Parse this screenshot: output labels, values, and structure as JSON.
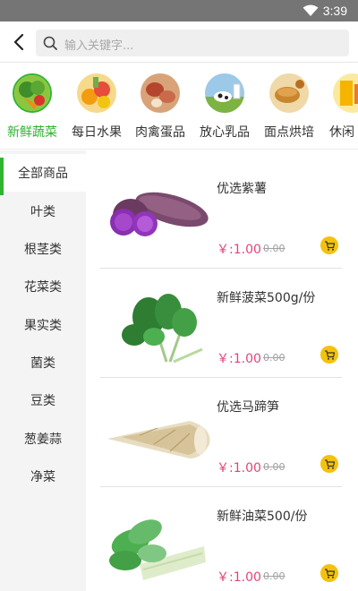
{
  "status_bar": {
    "time": "3:39"
  },
  "search": {
    "placeholder": "输入关键字..."
  },
  "top_categories": [
    {
      "label": "新鲜蔬菜",
      "active": true
    },
    {
      "label": "每日水果",
      "active": false
    },
    {
      "label": "肉禽蛋品",
      "active": false
    },
    {
      "label": "放心乳品",
      "active": false
    },
    {
      "label": "面点烘培",
      "active": false
    },
    {
      "label": "休闲",
      "active": false
    }
  ],
  "sidebar": {
    "items": [
      {
        "label": "全部商品",
        "active": true
      },
      {
        "label": "叶类",
        "active": false
      },
      {
        "label": "根茎类",
        "active": false
      },
      {
        "label": "花菜类",
        "active": false
      },
      {
        "label": "果实类",
        "active": false
      },
      {
        "label": "菌类",
        "active": false
      },
      {
        "label": "豆类",
        "active": false
      },
      {
        "label": "葱姜蒜",
        "active": false
      },
      {
        "label": "净菜",
        "active": false
      }
    ]
  },
  "products": [
    {
      "name": "优选紫薯",
      "price": "￥:1.00",
      "old_price": "0.00",
      "image": "purple-sweet-potato-image"
    },
    {
      "name": "新鲜菠菜500g/份",
      "price": "￥:1.00",
      "old_price": "0.00",
      "image": "spinach-image"
    },
    {
      "name": "优选马蹄笋",
      "price": "￥:1.00",
      "old_price": "0.00",
      "image": "bamboo-shoot-image"
    },
    {
      "name": "新鲜油菜500/份",
      "price": "￥:1.00",
      "old_price": "0.00",
      "image": "bok-choy-image"
    }
  ],
  "colors": {
    "accent_green": "#2fb52f",
    "price_pink": "#e0457b",
    "cart_yellow": "#f4c20d",
    "status_bar_gray": "#757575"
  }
}
